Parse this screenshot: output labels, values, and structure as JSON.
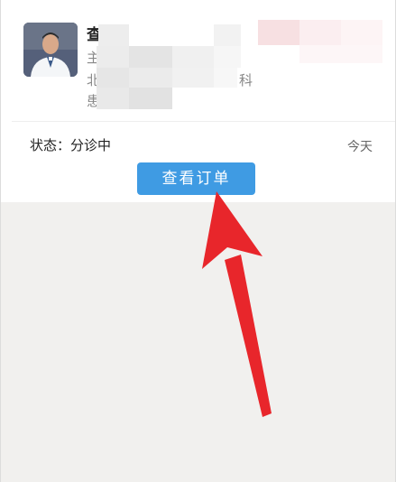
{
  "card": {
    "doctor_name_char": "查",
    "line2_char": "主",
    "line3_left_char": "北",
    "line3_right_char": "科",
    "line4_char": "患",
    "status_label": "状态：分诊中",
    "time_label": "今天",
    "view_order_button": "查看订单"
  },
  "colors": {
    "button": "#3f9be3",
    "arrow": "#e8262b",
    "page_bg": "#f1f0ee"
  }
}
